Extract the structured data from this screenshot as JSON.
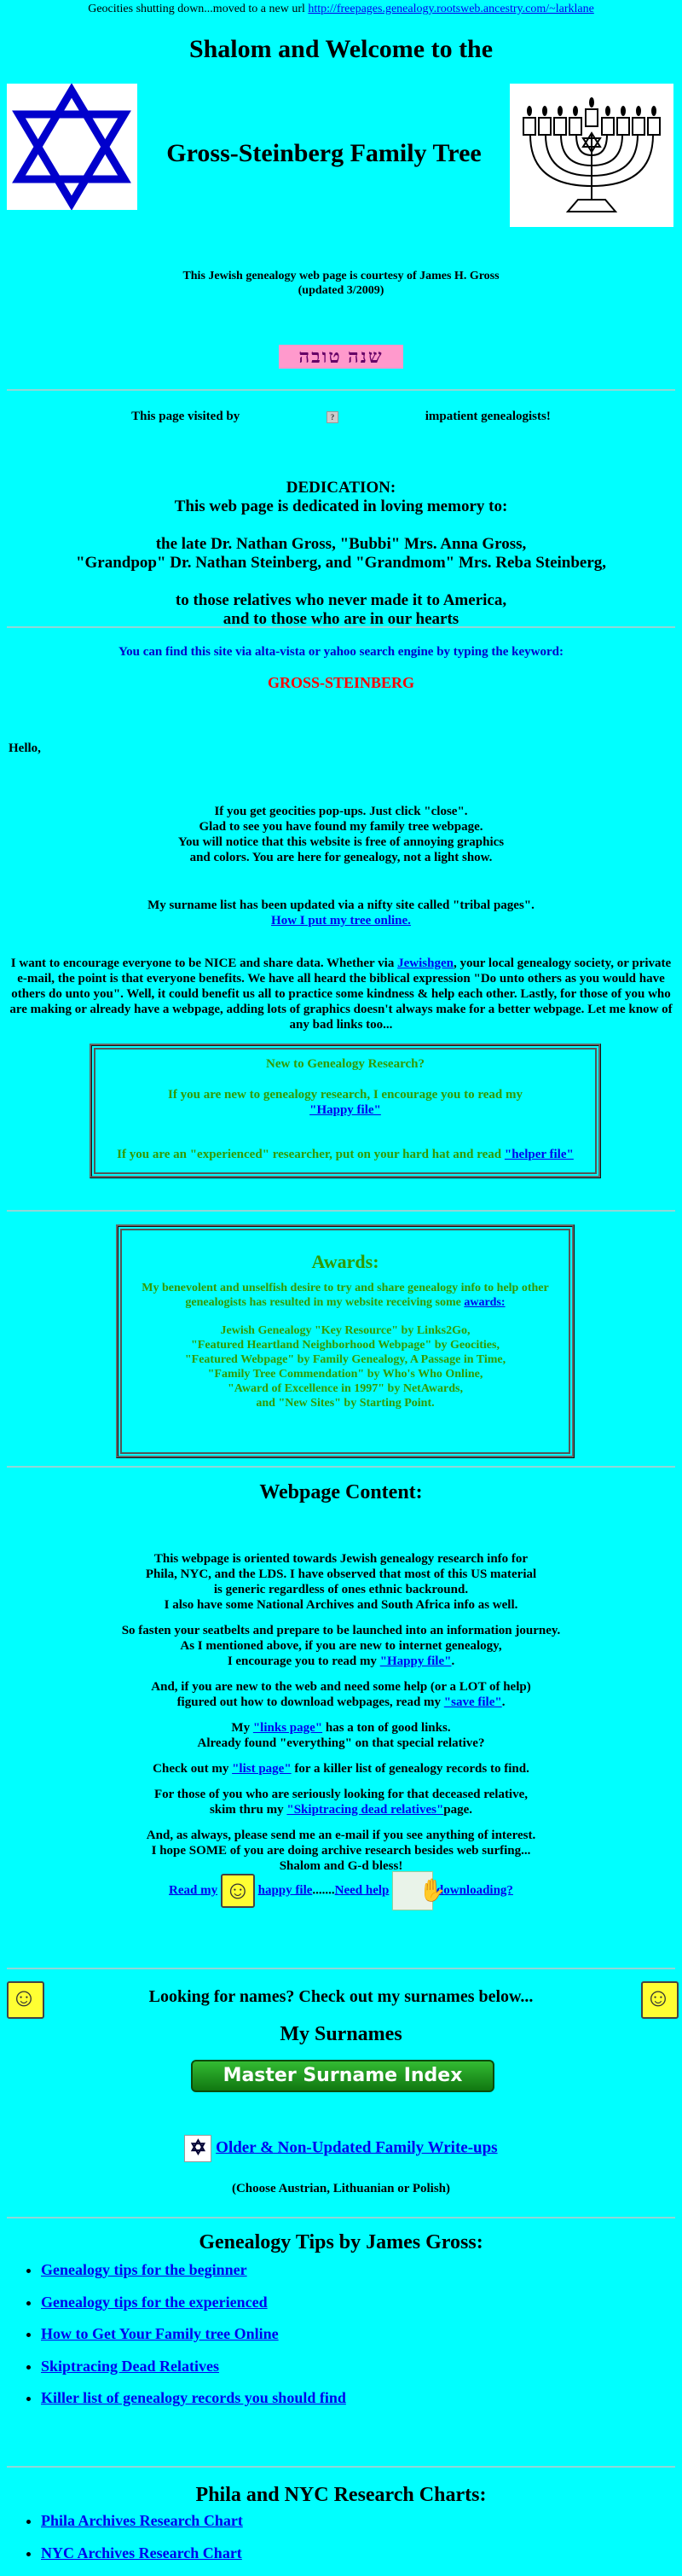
{
  "notice": {
    "text": "Geocities shutting down...moved to a new url ",
    "url": "http://freepages.genealogy.rootsweb.ancestry.com/~larklane"
  },
  "header": {
    "title": "Shalom and Welcome to the",
    "family_title": "Gross-Steinberg Family Tree"
  },
  "courtesy": {
    "line1": "This Jewish genealogy web page is courtesy of James H. Gross",
    "line2": "(updated 3/2009)"
  },
  "shana": "שנה טובה",
  "visitors": {
    "before": "This page visited by",
    "after": "impatient genealogists!"
  },
  "dedication": {
    "heading": "DEDICATION:",
    "line1": "This web page is dedicated in loving memory to:",
    "line2": "the late Dr. Nathan Gross, \"Bubbi\" Mrs. Anna Gross,",
    "line3": "\"Grandpop\" Dr. Nathan Steinberg, and \"Grandmom\" Mrs. Reba Steinberg,",
    "line4": "to those relatives who never made it to America,",
    "line5": "and to those who are in our hearts"
  },
  "search": {
    "text": "You can find this site via alta-vista or yahoo search engine by typing the keyword:",
    "keyword": "GROSS-STEINBERG"
  },
  "hello": "Hello,",
  "popups": {
    "line1": "If you get geocities pop-ups. Just click \"close\".",
    "line2": "Glad to see you have found my family tree webpage.",
    "line3": "You will notice that this website is free of annoying graphics",
    "line4": "and colors. You are here for genealogy, not a light show."
  },
  "surname_update": {
    "text": "My surname list has been updated via a nifty site called \"tribal pages\".",
    "link": "How I put my tree online."
  },
  "nice": {
    "before": "I want to encourage everyone to be NICE and share data. Whether via ",
    "link": "Jewishgen",
    "after": ", your local genealogy society, or private e-mail, the point is that everyone benefits. We have all heard the biblical expression \"Do unto others as you would have others do unto you\". Well, it could benefit us all to practice some kindness & help each other. Lastly, for those of you who are making or already have a webpage, adding lots of graphics doesn't always make for a better webpage. Let me know of any bad links too..."
  },
  "newbox": {
    "title": "New to Genealogy Research?",
    "line1": "If you are new to genealogy research, I encourage you to read my",
    "happy_link": "\"Happy file\"",
    "line2": "If you are an \"experienced\" researcher, put on your hard hat and read ",
    "helper_link": "\"helper file\""
  },
  "awards": {
    "title": "Awards:",
    "intro": "My benevolent and unselfish desire to try and share genealogy info to help other genealogists has resulted in my website receiving some ",
    "intro_link": "awards:",
    "items": [
      "Jewish Genealogy \"Key Resource\" by Links2Go,",
      "\"Featured Heartland Neighborhood Webpage\" by Geocities,",
      "\"Featured Webpage\" by Family Genealogy, A Passage in Time,",
      "\"Family Tree Commendation\" by Who's Who Online,",
      "\"Award of Excellence in 1997\" by NetAwards,",
      "and \"New Sites\" by Starting Point."
    ]
  },
  "content": {
    "title": "Webpage Content:",
    "p1": [
      "This webpage is oriented towards Jewish genealogy research info for",
      "Phila, NYC, and the LDS. I have observed that most of this US material",
      "is generic regardless of ones ethnic backround.",
      "I also have some National Archives and South Africa info as well."
    ],
    "p2": [
      "So fasten your seatbelts and prepare to be launched into an information journey.",
      "As I mentioned above, if you are new to internet genealogy,"
    ],
    "p2_before": "I encourage you to read my ",
    "p2_link": "\"Happy file\"",
    "p3_line": "And, if you are new to the web and need some help (or a LOT of help)",
    "p3_before": "figured out how to download webpages, read my ",
    "p3_link": "\"save file\"",
    "p4_before": "My ",
    "p4_link": "\"links page\"",
    "p4_after": " has a ton of good links.",
    "p4_line": "Already found \"everything\" on that special relative?",
    "p5_before": "Check out my ",
    "p5_link": "\"list page\"",
    "p5_after": " for a killer list of genealogy records to find.",
    "p6_line": "For those of you who are seriously looking for that deceased relative,",
    "p6_before": "skim thru my ",
    "p6_link": "\"Skiptracing dead relatives\"",
    "p6_after": "page.",
    "p7": [
      "And, as always, please send me an e-mail if you see anything of interest.",
      "I hope SOME of you are doing archive research besides web surfing...",
      "Shalom and G-d bless!"
    ]
  },
  "readmy": {
    "read": "Read my",
    "happy": "happy file",
    "dots": ".......",
    "need": "Need help",
    "download": "downloading?"
  },
  "surnames": {
    "looking": "Looking for names? Check out my surnames below...",
    "title": "My Surnames",
    "master_button": "Master Surname Index",
    "older_link": "Older & Non-Updated Family Write-ups",
    "choose": "(Choose Austrian, Lithuanian or Polish)"
  },
  "tips": {
    "title": "Genealogy Tips by James Gross:",
    "items": [
      "Genealogy tips for the beginner",
      "Genealogy tips for the experienced",
      "How to Get Your Family tree Online",
      "Skiptracing Dead Relatives",
      "Killer list of genealogy records you should find"
    ]
  },
  "charts": {
    "title": "Phila and NYC Research Charts:",
    "items": [
      "Phila Archives Research Chart",
      "NYC Archives Research Chart"
    ]
  }
}
